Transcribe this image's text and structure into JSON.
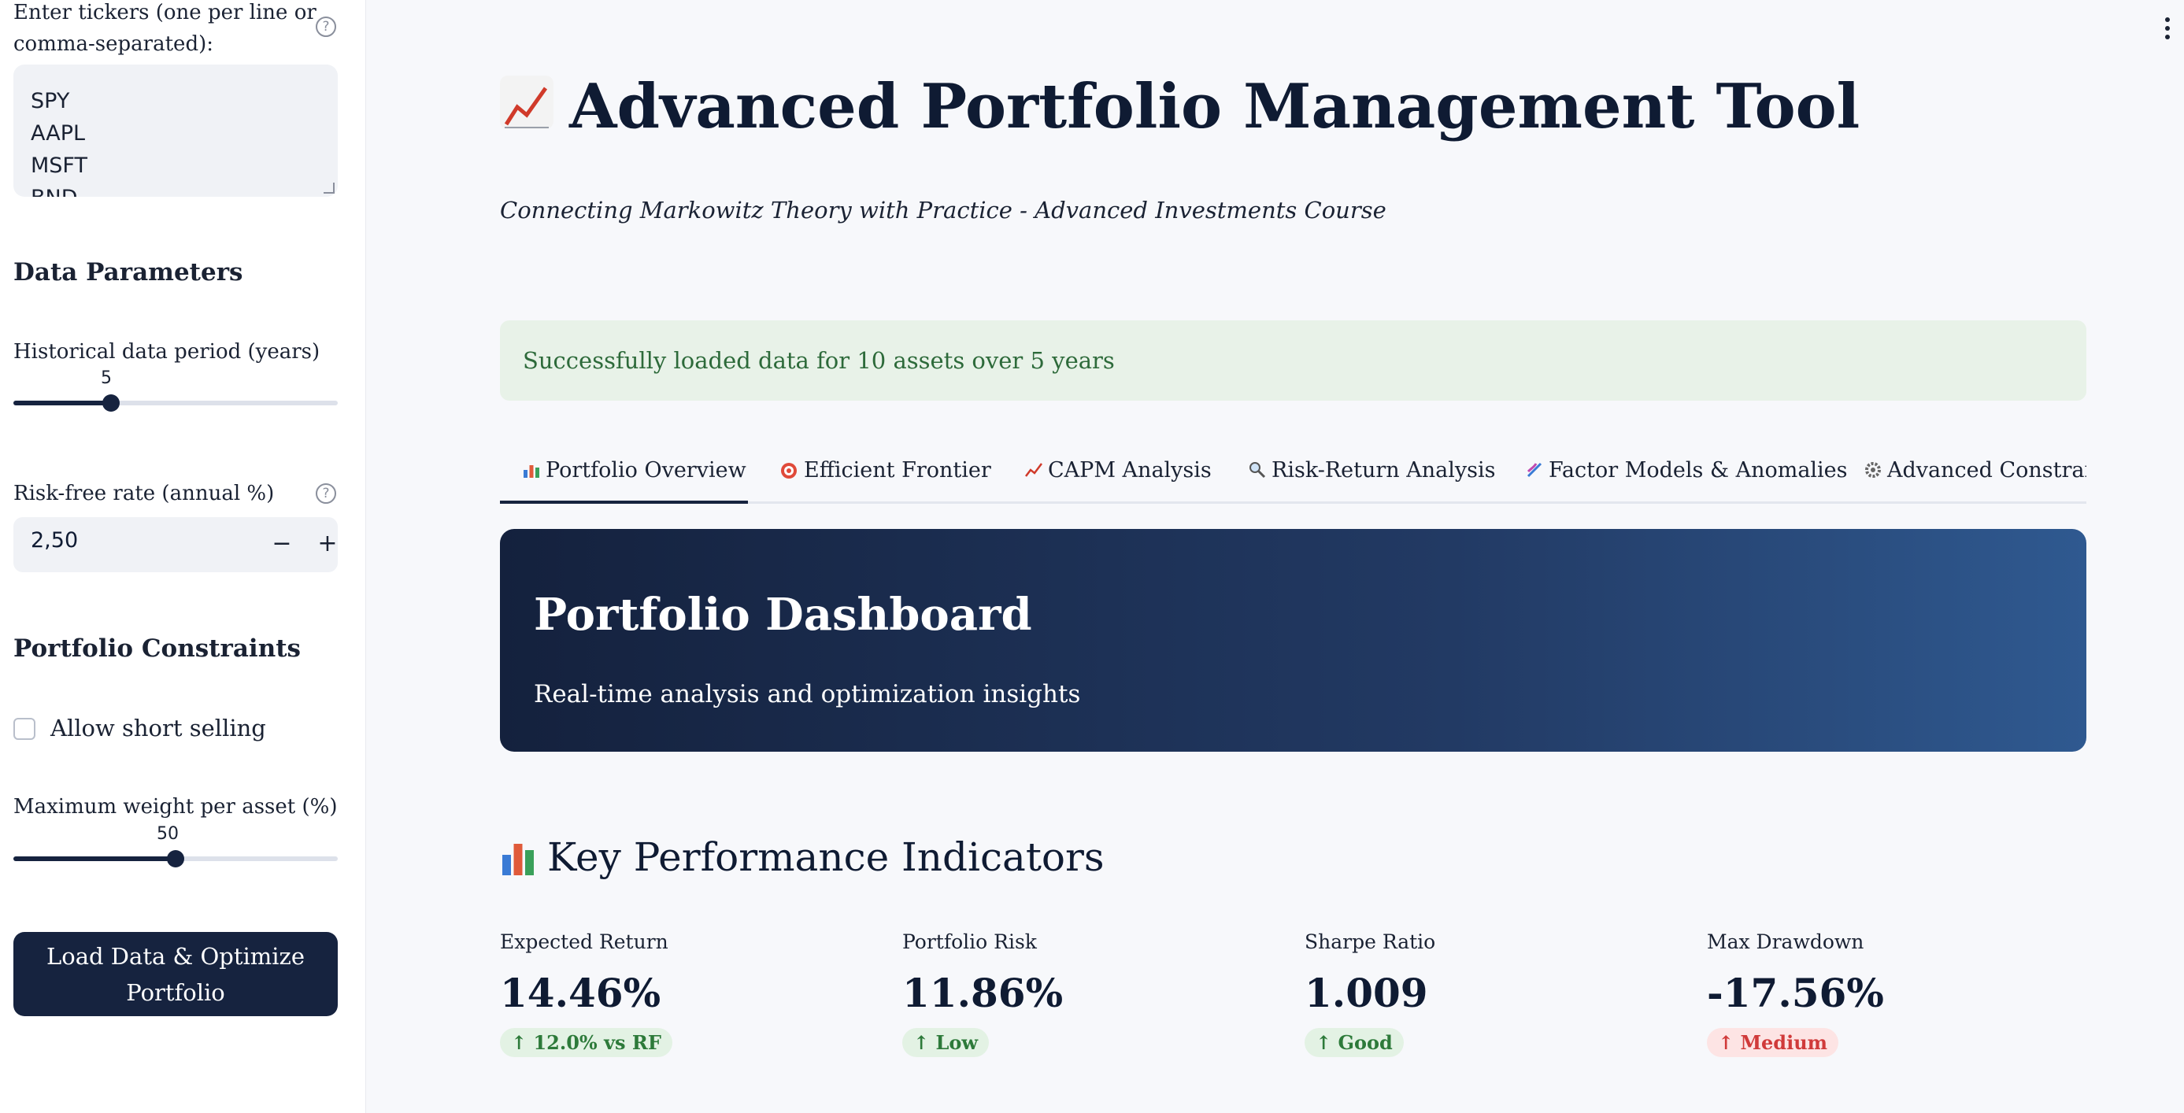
{
  "sidebar": {
    "tickers_label_line1": "Enter tickers (one per line or",
    "tickers_label_line2": "comma-separated):",
    "tickers_lines": [
      "SPY",
      "AAPL",
      "MSFT",
      "BND"
    ],
    "data_params_heading": "Data Parameters",
    "period_label": "Historical data period (years)",
    "period_value": "5",
    "period_fraction": 0.3,
    "rf_label": "Risk-free rate (annual %)",
    "rf_value": "2,50",
    "rf_minus": "−",
    "rf_plus": "+",
    "constraints_heading": "Portfolio Constraints",
    "short_selling_label": "Allow short selling",
    "short_selling_checked": false,
    "max_weight_label": "Maximum weight per asset (%)",
    "max_weight_value": "50",
    "max_weight_fraction": 0.5,
    "button_line1": "Load Data & Optimize",
    "button_line2": "Portfolio"
  },
  "header": {
    "title": "Advanced Portfolio Management Tool",
    "subtitle": "Connecting Markowitz Theory with Practice - Advanced Investments Course"
  },
  "alert": {
    "text": "Successfully loaded data for 10 assets over 5 years"
  },
  "tabs": [
    {
      "label": "Portfolio Overview",
      "icon": "bar-chart-icon",
      "active": true
    },
    {
      "label": "Efficient Frontier",
      "icon": "target-icon",
      "active": false
    },
    {
      "label": "CAPM Analysis",
      "icon": "chart-up-icon",
      "active": false
    },
    {
      "label": "Risk-Return Analysis",
      "icon": "magnifier-icon",
      "active": false
    },
    {
      "label": "Factor Models & Anomalies",
      "icon": "dna-icon",
      "active": false
    },
    {
      "label": "Advanced Constraint",
      "icon": "gear-icon",
      "active": false
    }
  ],
  "hero": {
    "title": "Portfolio Dashboard",
    "subtitle": "Real-time analysis and optimization insights"
  },
  "kpi": {
    "heading": "Key Performance Indicators",
    "metrics": [
      {
        "label": "Expected Return",
        "value": "14.46%",
        "delta": "↑ 12.0% vs RF",
        "status": "good"
      },
      {
        "label": "Portfolio Risk",
        "value": "11.86%",
        "delta": "↑ Low",
        "status": "good"
      },
      {
        "label": "Sharpe Ratio",
        "value": "1.009",
        "delta": "↑ Good",
        "status": "good"
      },
      {
        "label": "Max Drawdown",
        "value": "-17.56%",
        "delta": "↑ Medium",
        "status": "bad"
      }
    ]
  },
  "colors": {
    "primary": "#16233f",
    "success_bg": "#e8f2e8",
    "success_text": "#2d6a3a",
    "danger": "#d03a3a"
  }
}
